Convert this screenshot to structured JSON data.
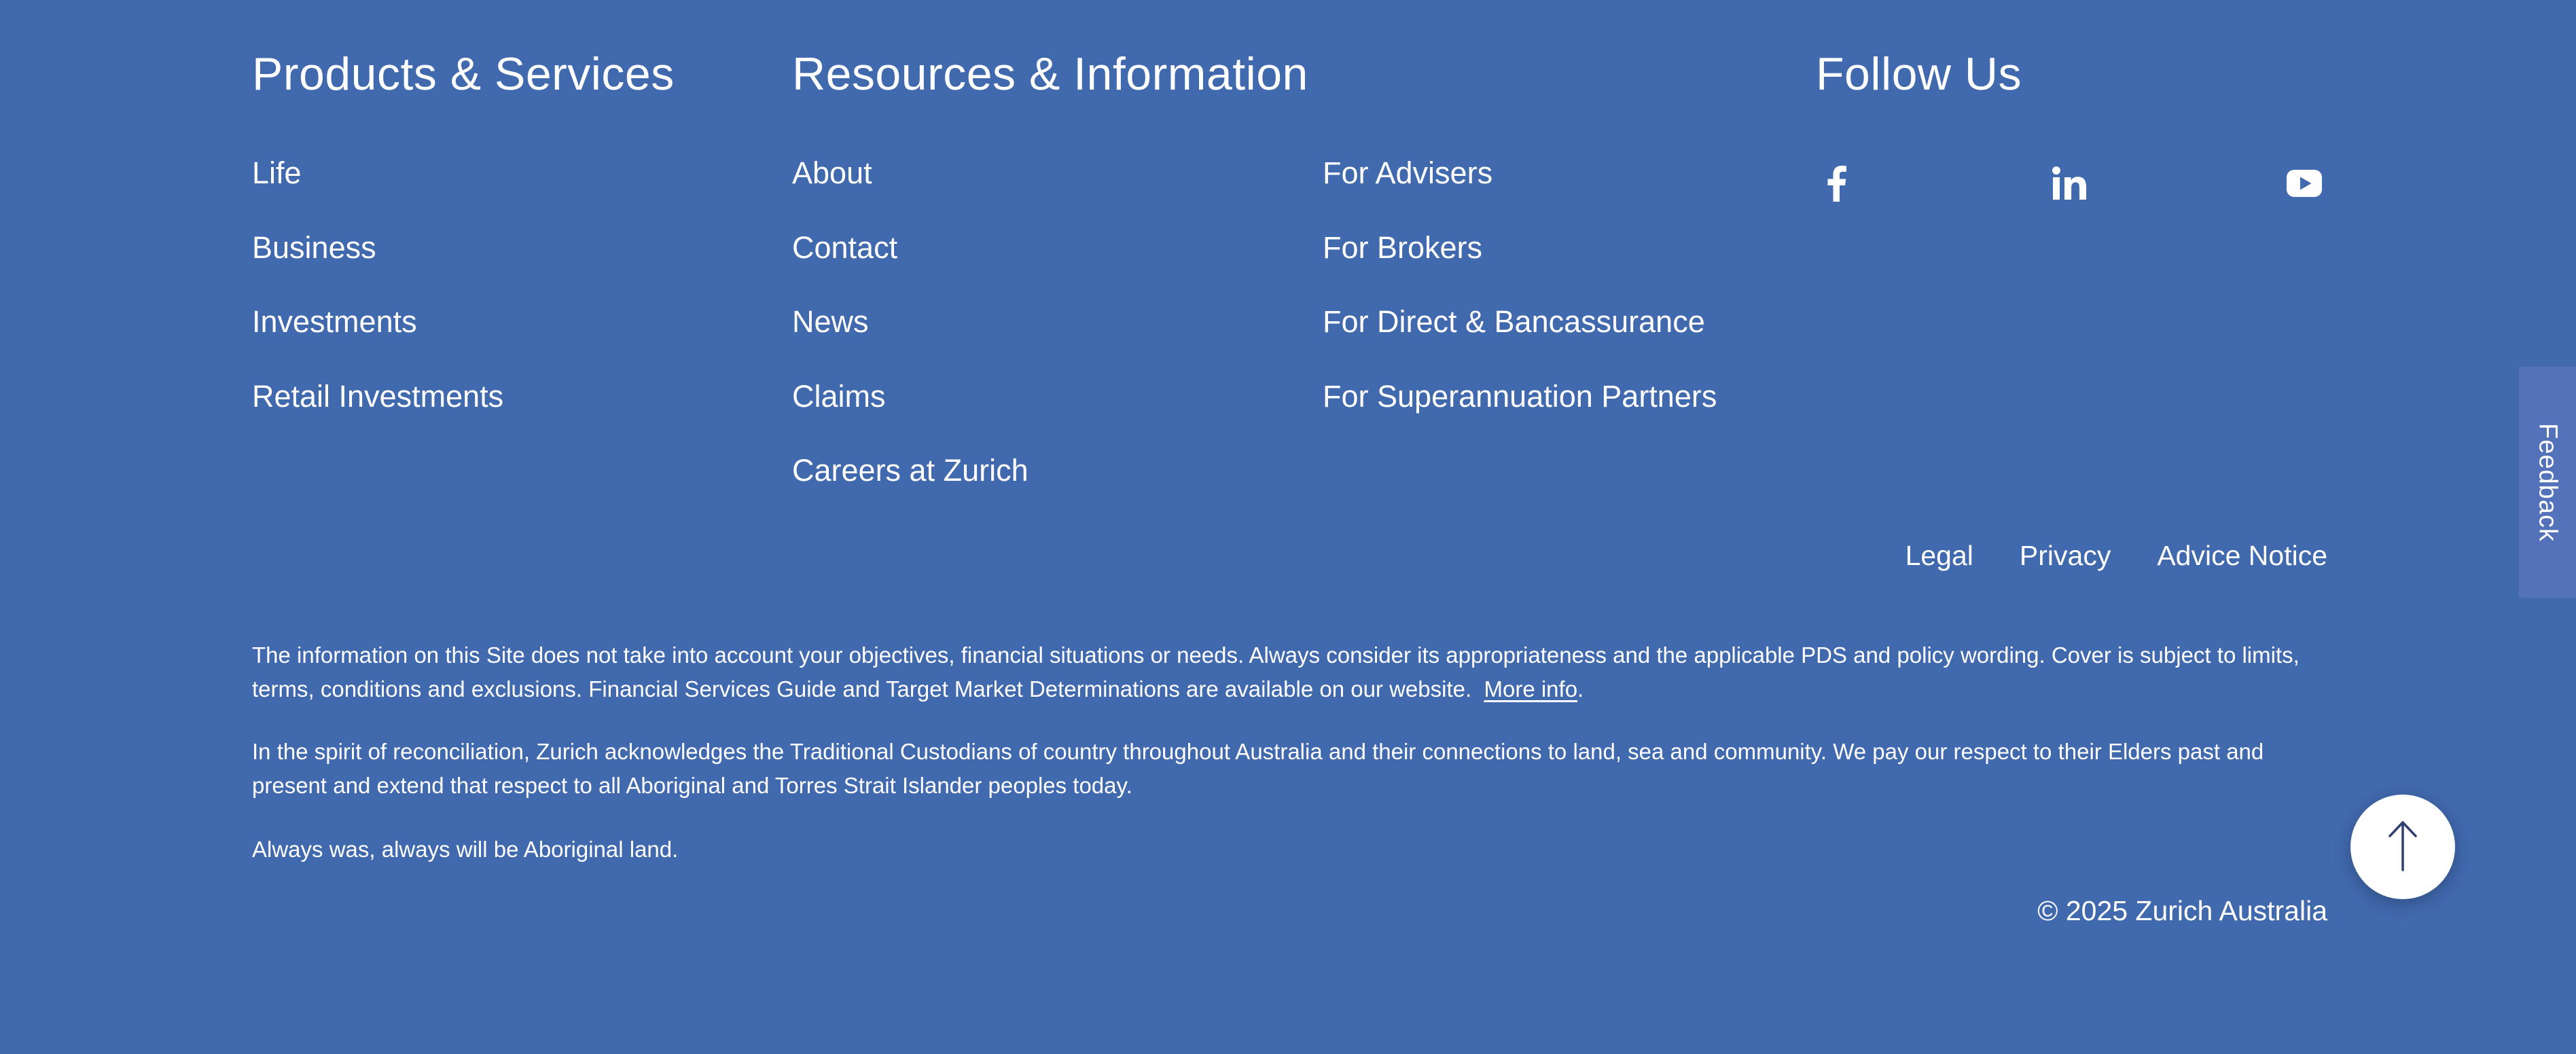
{
  "products": {
    "heading": "Products & Services",
    "links": [
      "Life",
      "Business",
      "Investments",
      "Retail Investments"
    ]
  },
  "resources": {
    "heading": "Resources & Information",
    "links_col1": [
      "About",
      "Contact",
      "News",
      "Claims",
      "Careers at Zurich"
    ],
    "links_col2": [
      "For Advisers",
      "For Brokers",
      "For Direct & Bancassurance",
      "For Superannuation Partners"
    ]
  },
  "follow": {
    "heading": "Follow Us",
    "icons": [
      "facebook-icon",
      "linkedin-icon",
      "youtube-icon"
    ]
  },
  "legal": {
    "legal_label": "Legal",
    "privacy_label": "Privacy",
    "advice_label": "Advice Notice"
  },
  "disclaimer": {
    "text": "The information on this Site does not take into account your objectives, financial situations or needs. Always consider its appropriateness and the applicable PDS and policy wording. Cover is subject to limits, terms, conditions and exclusions. Financial Services Guide and Target Market Determinations are available on our website.",
    "more_info_label": "More info"
  },
  "acknowledgement": {
    "text": "In the spirit of reconciliation, Zurich acknowledges the Traditional Custodians of country throughout Australia and their connections to land, sea and community. We pay our respect to their Elders past and present and extend that respect to all Aboriginal and Torres Strait Islander peoples today.",
    "closing": "Always was, always will be Aboriginal land."
  },
  "copyright": "© 2025 Zurich Australia",
  "feedback_label": "Feedback",
  "colors": {
    "background": "#4169ae",
    "feedback_tab": "#5472b9",
    "text": "#ffffff",
    "arrow": "#2d3f6e"
  }
}
